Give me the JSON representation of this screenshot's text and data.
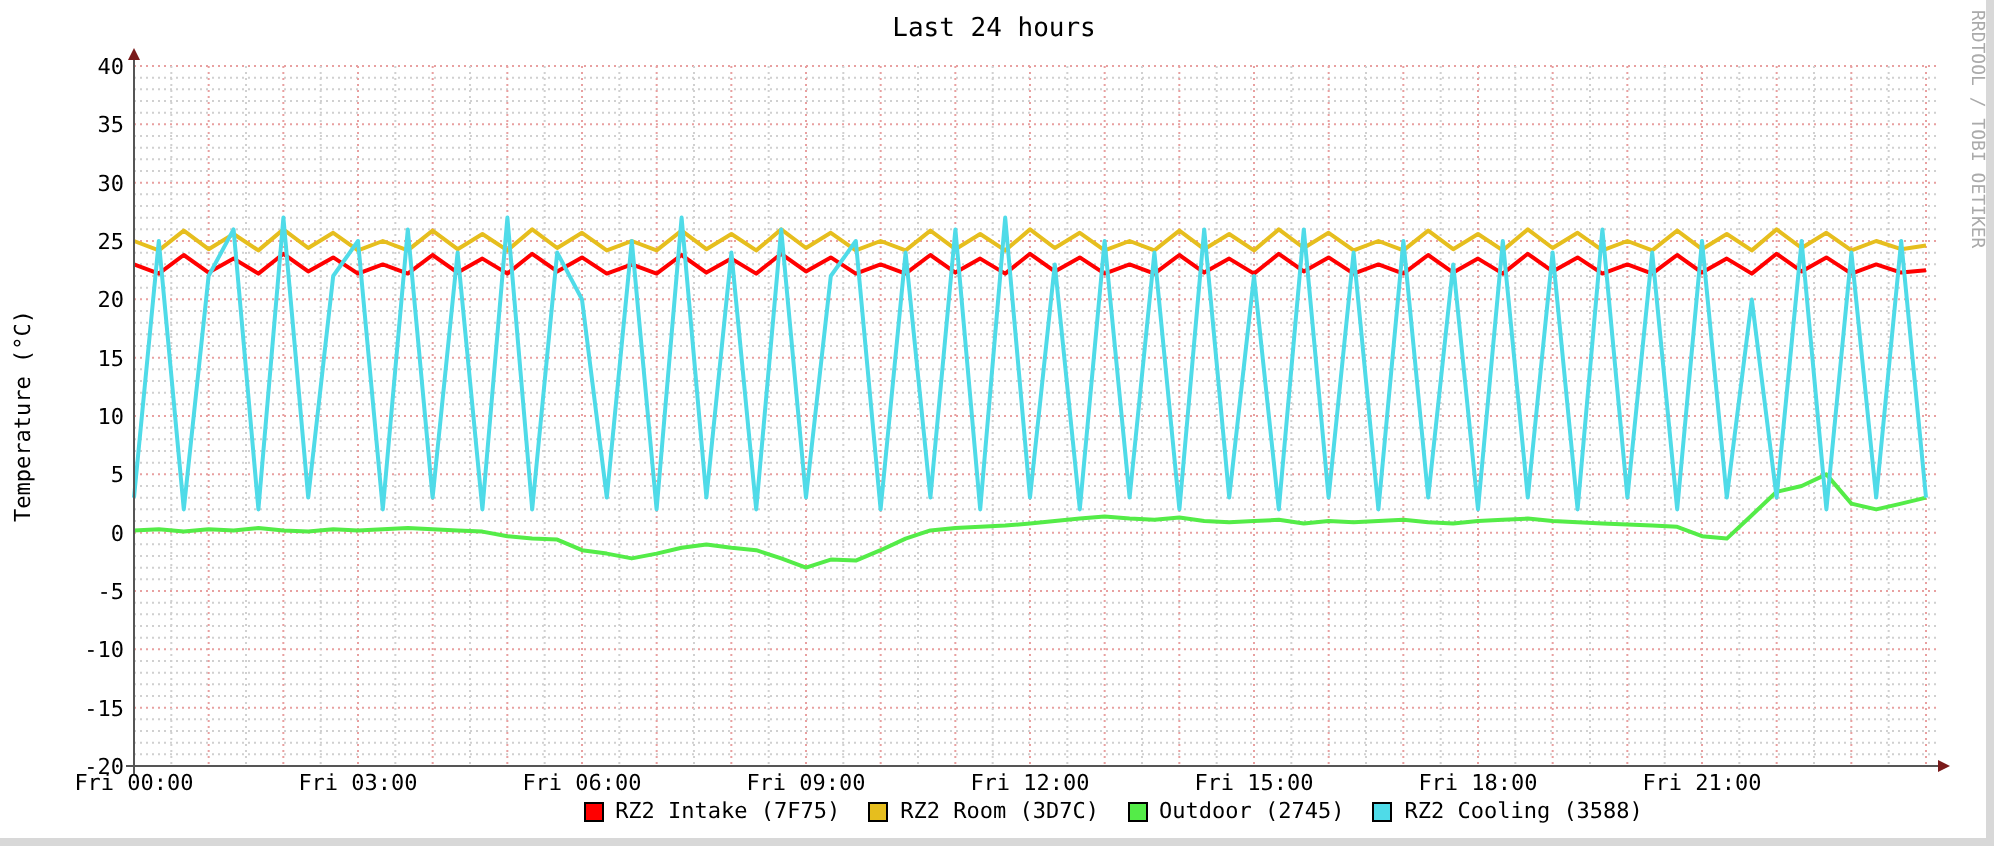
{
  "side_text": "RRDTOOL / TOBI OETIKER",
  "chart_data": {
    "type": "line",
    "title": "Last 24 hours",
    "ylabel": "Temperature (°C)",
    "categories": [
      "Fri 00:00",
      null,
      null,
      null,
      null,
      null,
      null,
      null,
      null,
      "Fri 03:00",
      null,
      null,
      null,
      null,
      null,
      null,
      null,
      null,
      "Fri 06:00",
      null,
      null,
      null,
      null,
      null,
      null,
      null,
      null,
      "Fri 09:00",
      null,
      null,
      null,
      null,
      null,
      null,
      null,
      null,
      "Fri 12:00",
      null,
      null,
      null,
      null,
      null,
      null,
      null,
      null,
      "Fri 15:00",
      null,
      null,
      null,
      null,
      null,
      null,
      null,
      null,
      "Fri 18:00",
      null,
      null,
      null,
      null,
      null,
      null,
      null,
      null,
      "Fri 21:00",
      null,
      null,
      null,
      null,
      null,
      null,
      null,
      null,
      null
    ],
    "ylim": [
      -20,
      40
    ],
    "grid": true,
    "yticks": [
      -20,
      -15,
      -10,
      -5,
      0,
      5,
      10,
      15,
      20,
      25,
      30,
      35,
      40
    ],
    "series": [
      {
        "name": "RZ2 Intake (7F75)",
        "color": "#ff0000",
        "values": [
          23,
          22.2,
          23.8,
          22.3,
          23.5,
          22.2,
          23.9,
          22.4,
          23.6,
          22.2,
          23,
          22.2,
          23.8,
          22.3,
          23.5,
          22.2,
          23.9,
          22.4,
          23.6,
          22.2,
          23,
          22.2,
          23.8,
          22.3,
          23.5,
          22.2,
          23.9,
          22.4,
          23.6,
          22.2,
          23,
          22.2,
          23.8,
          22.3,
          23.5,
          22.2,
          23.9,
          22.4,
          23.6,
          22.2,
          23,
          22.2,
          23.8,
          22.3,
          23.5,
          22.2,
          23.9,
          22.4,
          23.6,
          22.2,
          23,
          22.2,
          23.8,
          22.3,
          23.5,
          22.2,
          23.9,
          22.4,
          23.6,
          22.2,
          23,
          22.2,
          23.8,
          22.3,
          23.5,
          22.2,
          23.9,
          22.4,
          23.6,
          22.2,
          23,
          22.3,
          22.5
        ]
      },
      {
        "name": "RZ2 Room (3D7C)",
        "color": "#e6be1e",
        "values": [
          25,
          24.2,
          25.9,
          24.3,
          25.6,
          24.2,
          26,
          24.4,
          25.7,
          24.2,
          25,
          24.2,
          25.9,
          24.3,
          25.6,
          24.2,
          26,
          24.4,
          25.7,
          24.2,
          25,
          24.2,
          25.9,
          24.3,
          25.6,
          24.2,
          26,
          24.4,
          25.7,
          24.2,
          25,
          24.2,
          25.9,
          24.3,
          25.6,
          24.2,
          26,
          24.4,
          25.7,
          24.2,
          25,
          24.2,
          25.9,
          24.3,
          25.6,
          24.2,
          26,
          24.4,
          25.7,
          24.2,
          25,
          24.2,
          25.9,
          24.3,
          25.6,
          24.2,
          26,
          24.4,
          25.7,
          24.2,
          25,
          24.2,
          25.9,
          24.3,
          25.6,
          24.2,
          26,
          24.4,
          25.7,
          24.2,
          25,
          24.3,
          24.6
        ]
      },
      {
        "name": "Outdoor (2745)",
        "color": "#54ec48",
        "values": [
          0.2,
          0.3,
          0.1,
          0.3,
          0.2,
          0.4,
          0.2,
          0.1,
          0.3,
          0.2,
          0.3,
          0.4,
          0.3,
          0.2,
          0.1,
          -0.3,
          -0.5,
          -0.6,
          -1.5,
          -1.8,
          -2.2,
          -1.8,
          -1.3,
          -1,
          -1.3,
          -1.5,
          -2.2,
          -3,
          -2.3,
          -2.4,
          -1.5,
          -0.5,
          0.2,
          0.4,
          0.5,
          0.6,
          0.8,
          1,
          1.2,
          1.4,
          1.2,
          1.1,
          1.3,
          1,
          0.9,
          1,
          1.1,
          0.8,
          1,
          0.9,
          1,
          1.1,
          0.9,
          0.8,
          1,
          1.1,
          1.2,
          1,
          0.9,
          0.8,
          0.7,
          0.6,
          0.5,
          -0.3,
          -0.5,
          1.5,
          3.5,
          4,
          5,
          2.5,
          2,
          2.5,
          3
        ]
      },
      {
        "name": "RZ2 Cooling (3588)",
        "color": "#4fdbe8",
        "values": [
          3,
          25,
          2,
          22,
          26,
          2,
          27,
          3,
          22,
          25,
          2,
          26,
          3,
          24,
          2,
          27,
          2,
          24,
          20,
          3,
          25,
          2,
          27,
          3,
          24,
          2,
          26,
          3,
          22,
          25,
          2,
          24,
          3,
          26,
          2,
          27,
          3,
          23,
          2,
          25,
          3,
          24,
          2,
          26,
          3,
          22,
          2,
          26,
          3,
          24,
          2,
          25,
          3,
          23,
          2,
          25,
          3,
          24,
          2,
          26,
          3,
          24,
          2,
          25,
          3,
          20,
          3,
          25,
          2,
          24,
          3,
          25,
          3
        ]
      }
    ]
  }
}
